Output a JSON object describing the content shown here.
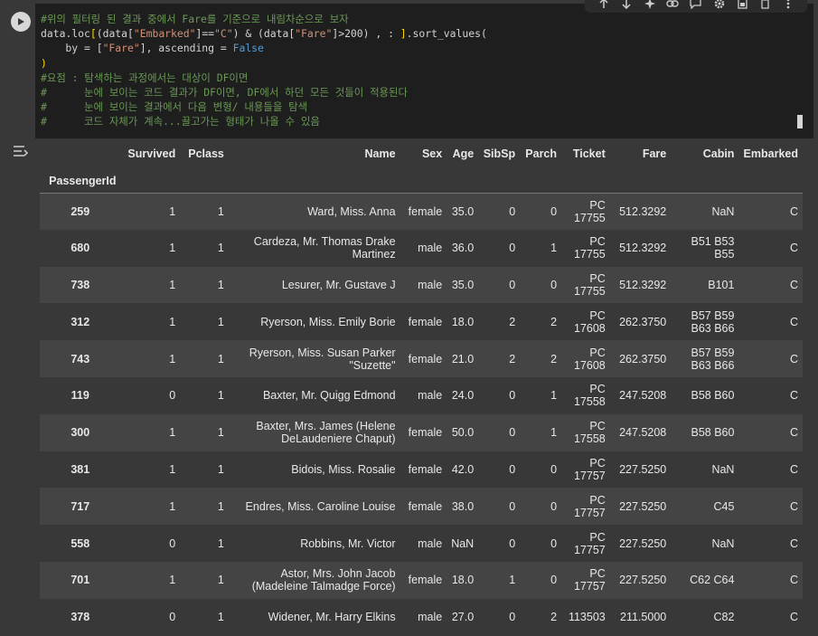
{
  "toolbar": {
    "icons": [
      "arrow-up-icon",
      "arrow-down-icon",
      "sparkle-icon",
      "link-icon",
      "comment-icon",
      "gear-icon",
      "mirror-cell-icon",
      "trash-icon",
      "more-vert-icon"
    ]
  },
  "code": {
    "lines": [
      [
        {
          "t": "#위의 필터링 된 결과 중에서 Fare를 기준으로 내림차순으로 보자",
          "c": "c-comment"
        }
      ],
      [
        {
          "t": "data.loc",
          "c": "c-plain"
        },
        {
          "t": "[",
          "c": "c-brk"
        },
        {
          "t": "(data[",
          "c": "c-plain"
        },
        {
          "t": "\"Embarked\"",
          "c": "c-str"
        },
        {
          "t": "]==",
          "c": "c-plain"
        },
        {
          "t": "\"C\"",
          "c": "c-str"
        },
        {
          "t": ") & (data[",
          "c": "c-plain"
        },
        {
          "t": "\"Fare\"",
          "c": "c-str"
        },
        {
          "t": "]>200) , : ",
          "c": "c-plain"
        },
        {
          "t": "]",
          "c": "c-brk"
        },
        {
          "t": ".sort_values(",
          "c": "c-plain"
        }
      ],
      [
        {
          "t": "    by = [",
          "c": "c-plain"
        },
        {
          "t": "\"Fare\"",
          "c": "c-str"
        },
        {
          "t": "], ascending = ",
          "c": "c-plain"
        },
        {
          "t": "False",
          "c": "c-kw"
        }
      ],
      [
        {
          "t": ")",
          "c": "c-brk"
        }
      ],
      [
        {
          "t": "#요점 : 탐색하는 과정에서는 대상이 DF이면",
          "c": "c-comment"
        }
      ],
      [
        {
          "t": "#      눈에 보이는 코드 결과가 DF이면, DF에서 하던 모든 것들이 적용된다",
          "c": "c-comment"
        }
      ],
      [
        {
          "t": "#      눈에 보이는 결과에서 다음 변형/ 내용들을 탐색",
          "c": "c-comment"
        }
      ],
      [
        {
          "t": "#      코드 자체가 계속...끌고가는 형태가 나올 수 있음",
          "c": "c-comment"
        }
      ]
    ]
  },
  "table": {
    "columns": [
      "Survived",
      "Pclass",
      "Name",
      "Sex",
      "Age",
      "SibSp",
      "Parch",
      "Ticket",
      "Fare",
      "Cabin",
      "Embarked"
    ],
    "index_name": "PassengerId",
    "rows": [
      {
        "id": "259",
        "cells": [
          "1",
          "1",
          "Ward, Miss. Anna",
          "female",
          "35.0",
          "0",
          "0",
          "PC 17755",
          "512.3292",
          "NaN",
          "C"
        ]
      },
      {
        "id": "680",
        "cells": [
          "1",
          "1",
          "Cardeza, Mr. Thomas Drake Martinez",
          "male",
          "36.0",
          "0",
          "1",
          "PC 17755",
          "512.3292",
          "B51 B53 B55",
          "C"
        ]
      },
      {
        "id": "738",
        "cells": [
          "1",
          "1",
          "Lesurer, Mr. Gustave J",
          "male",
          "35.0",
          "0",
          "0",
          "PC 17755",
          "512.3292",
          "B101",
          "C"
        ]
      },
      {
        "id": "312",
        "cells": [
          "1",
          "1",
          "Ryerson, Miss. Emily Borie",
          "female",
          "18.0",
          "2",
          "2",
          "PC 17608",
          "262.3750",
          "B57 B59 B63 B66",
          "C"
        ]
      },
      {
        "id": "743",
        "cells": [
          "1",
          "1",
          "Ryerson, Miss. Susan Parker \"Suzette\"",
          "female",
          "21.0",
          "2",
          "2",
          "PC 17608",
          "262.3750",
          "B57 B59 B63 B66",
          "C"
        ]
      },
      {
        "id": "119",
        "cells": [
          "0",
          "1",
          "Baxter, Mr. Quigg Edmond",
          "male",
          "24.0",
          "0",
          "1",
          "PC 17558",
          "247.5208",
          "B58 B60",
          "C"
        ]
      },
      {
        "id": "300",
        "cells": [
          "1",
          "1",
          "Baxter, Mrs. James (Helene DeLaudeniere Chaput)",
          "female",
          "50.0",
          "0",
          "1",
          "PC 17558",
          "247.5208",
          "B58 B60",
          "C"
        ]
      },
      {
        "id": "381",
        "cells": [
          "1",
          "1",
          "Bidois, Miss. Rosalie",
          "female",
          "42.0",
          "0",
          "0",
          "PC 17757",
          "227.5250",
          "NaN",
          "C"
        ]
      },
      {
        "id": "717",
        "cells": [
          "1",
          "1",
          "Endres, Miss. Caroline Louise",
          "female",
          "38.0",
          "0",
          "0",
          "PC 17757",
          "227.5250",
          "C45",
          "C"
        ]
      },
      {
        "id": "558",
        "cells": [
          "0",
          "1",
          "Robbins, Mr. Victor",
          "male",
          "NaN",
          "0",
          "0",
          "PC 17757",
          "227.5250",
          "NaN",
          "C"
        ]
      },
      {
        "id": "701",
        "cells": [
          "1",
          "1",
          "Astor, Mrs. John Jacob (Madeleine Talmadge Force)",
          "female",
          "18.0",
          "1",
          "0",
          "PC 17757",
          "227.5250",
          "C62 C64",
          "C"
        ]
      },
      {
        "id": "378",
        "cells": [
          "0",
          "1",
          "Widener, Mr. Harry Elkins",
          "male",
          "27.0",
          "0",
          "2",
          "113503",
          "211.5000",
          "C82",
          "C"
        ]
      }
    ]
  }
}
